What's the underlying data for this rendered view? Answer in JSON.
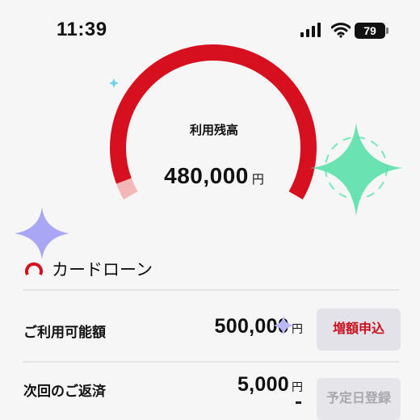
{
  "status_bar": {
    "time": "11:39",
    "battery": "79"
  },
  "gauge": {
    "label": "利用残高",
    "amount": "480,000",
    "unit": "円",
    "used_fraction": 0.96
  },
  "section": {
    "title": "カードローン"
  },
  "rows": [
    {
      "label": "ご利用可能額",
      "amount": "500,000",
      "unit": "円",
      "button": "増額申込"
    },
    {
      "label": "次回のご返済",
      "amount": "5,000",
      "unit": "円",
      "button": "予定日登録",
      "extra": "-"
    }
  ],
  "colors": {
    "accent": "#d7101f",
    "gauge_light": "#f4b7b7"
  }
}
